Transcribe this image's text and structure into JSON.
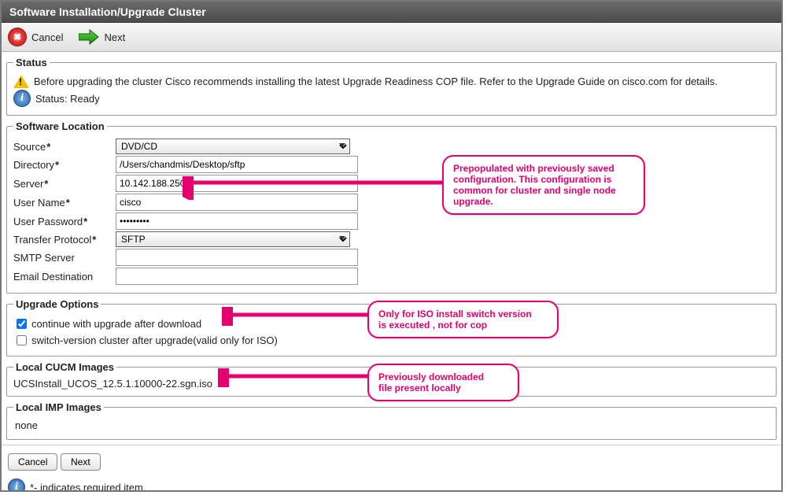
{
  "title": "Software Installation/Upgrade Cluster",
  "toolbar": {
    "cancel_label": "Cancel",
    "next_label": "Next"
  },
  "status": {
    "legend": "Status",
    "warning_text": "Before upgrading the cluster Cisco recommends installing the latest Upgrade Readiness COP file. Refer to the Upgrade Guide on cisco.com for details.",
    "ready_text": "Status: Ready"
  },
  "software_location": {
    "legend": "Software Location",
    "labels": {
      "source": "Source",
      "directory": "Directory",
      "server": "Server",
      "user_name": "User Name",
      "user_password": "User Password",
      "transfer_protocol": "Transfer Protocol",
      "smtp_server": "SMTP Server",
      "email_destination": "Email Destination"
    },
    "values": {
      "source": "DVD/CD",
      "directory": "/Users/chandmis/Desktop/sftp",
      "server": "10.142.188.250",
      "user_name": "cisco",
      "user_password": "•••••••••",
      "transfer_protocol": "SFTP",
      "smtp_server": "",
      "email_destination": ""
    }
  },
  "upgrade_options": {
    "legend": "Upgrade Options",
    "continue_label": "continue with upgrade after download",
    "continue_checked": true,
    "switch_version_label": "switch-version cluster after upgrade(valid only for ISO)",
    "switch_version_checked": false
  },
  "local_cucm": {
    "legend": "Local CUCM Images",
    "item": "UCSInstall_UCOS_12.5.1.10000-22.sgn.iso"
  },
  "local_imp": {
    "legend": "Local IMP Images",
    "item": "none"
  },
  "bottom_buttons": {
    "cancel": "Cancel",
    "next": "Next"
  },
  "footer_note": "*- indicates required item.",
  "callouts": {
    "c1_line1": "Prepopulated with previously saved",
    "c1_line2": "configuration. This configuration is",
    "c1_line3": "common for cluster and single node",
    "c1_line4": "upgrade.",
    "c2_line1": "Only for ISO install switch version",
    "c2_line2": "is executed , not for cop",
    "c3_line1": "Previously downloaded",
    "c3_line2": "file present locally"
  }
}
